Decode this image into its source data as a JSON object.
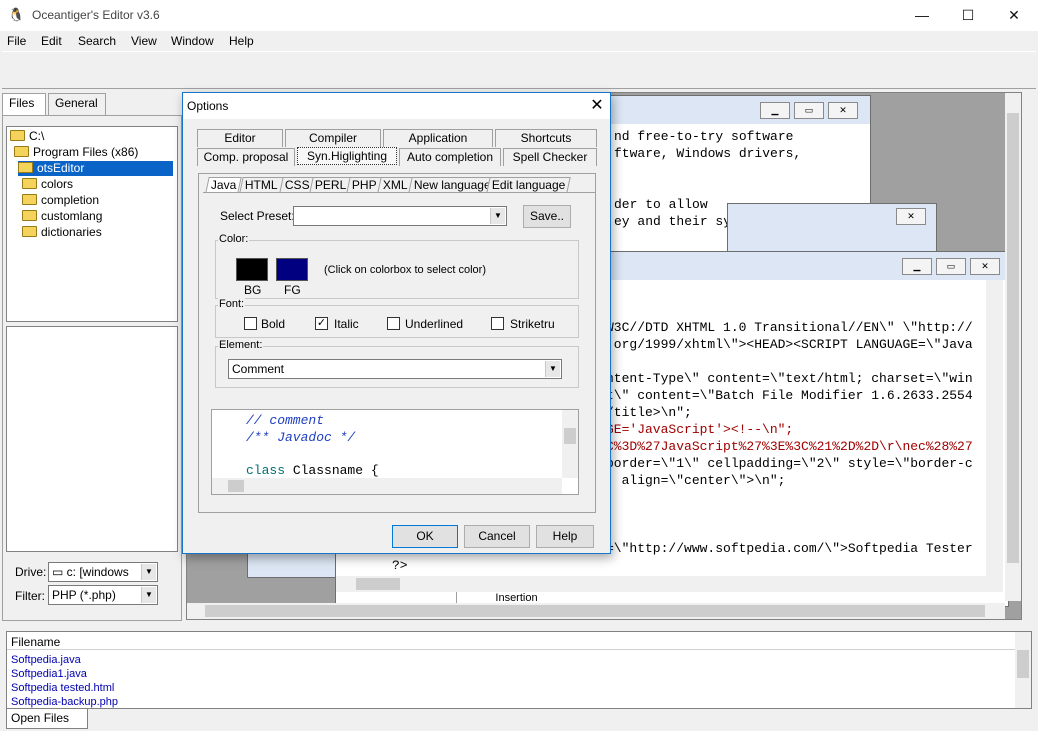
{
  "app": {
    "title": "Oceantiger's Editor v3.6",
    "icon": "app-logo-icon"
  },
  "window_controls": {
    "minimize": "—",
    "maximize": "☐",
    "close": "✕"
  },
  "menu": {
    "items": [
      {
        "label": "File"
      },
      {
        "label": "Edit"
      },
      {
        "label": "Search"
      },
      {
        "label": "View"
      },
      {
        "label": "Window"
      },
      {
        "label": "Help"
      }
    ]
  },
  "left_panel": {
    "tabs": [
      "Files",
      "General"
    ],
    "tree": [
      {
        "label": "C:\\"
      },
      {
        "label": "Program Files (x86)"
      },
      {
        "label": "otsEditor",
        "selected": true
      },
      {
        "label": "colors"
      },
      {
        "label": "completion"
      },
      {
        "label": "customlang"
      },
      {
        "label": "dictionaries"
      }
    ],
    "drive_label": "Drive:",
    "drive_value": "c: [windows",
    "filter_label": "Filter:",
    "filter_value": "PHP (*.php)"
  },
  "editor_back": {
    "lines": [
      "nd free-to-try software",
      "ftware, Windows drivers,",
      "",
      "",
      "der to allow",
      "ey and their system needs."
    ]
  },
  "editor_front": {
    "lines": [
      "W3C//DTD XHTML 1.0 Transitional//EN\\\" \\\"http://",
      ".org/1999/xhtml\\\"><HEAD><SCRIPT LANGUAGE=\\\"Java",
      "",
      "ntent-Type\\\" content=\\\"text/html; charset=\\\"win",
      "t\\\" content=\\\"Batch File Modifier 1.6.2633.2554",
      "/title>\\n\";",
      "GE='JavaScript'><!--\\n\";",
      "C%3D%27JavaScript%27%3E%3C%21%2D%2D\\r\\nec%28%27",
      "border=\\\"1\\\" cellpadding=\\\"2\\\" style=\\\"border-c",
      "' align=\\\"center\\\">\\n\";",
      "",
      "",
      "",
      "=\\\"http://www.softpedia.com/\\\">Softpedia Tester"
    ],
    "last_line": "?>",
    "status_cell": "Insertion"
  },
  "dialog": {
    "title": "Options",
    "close": "✕",
    "tabs_row1": [
      "Editor",
      "Compiler",
      "Application",
      "Shortcuts"
    ],
    "tabs_row2": [
      "Comp. proposal",
      "Syn.Higlighting",
      "Auto completion",
      "Spell Checker"
    ],
    "active_tab": "Syn.Higlighting",
    "subtabs": [
      "Java",
      "HTML",
      "CSS",
      "PERL",
      "PHP",
      "XML",
      "New language",
      "Edit language"
    ],
    "active_subtab": "Java",
    "preset_label": "Select Preset:",
    "preset_value": "",
    "save_button": "Save..",
    "color_group": "Color:",
    "bg_label": "BG",
    "fg_label": "FG",
    "bg_color": "#000000",
    "fg_color": "#000080",
    "color_hint": "(Click on colorbox to select color)",
    "font_group": "Font:",
    "font_options": [
      {
        "label": "Bold",
        "checked": false
      },
      {
        "label": "Italic",
        "checked": true
      },
      {
        "label": "Underlined",
        "checked": false
      },
      {
        "label": "Striketru",
        "checked": false
      }
    ],
    "element_group": "Element:",
    "element_value": "Comment",
    "sample": {
      "lines": [
        "// comment",
        "/** Javadoc */",
        "",
        "class Classname {"
      ]
    },
    "ok": "OK",
    "cancel": "Cancel",
    "help": "Help"
  },
  "filelist": {
    "header": "Filename",
    "files": [
      "Softpedia.java",
      "Softpedia1.java",
      "Softpedia tested.html",
      "Softpedia-backup.php"
    ],
    "tab": "Open Files"
  }
}
